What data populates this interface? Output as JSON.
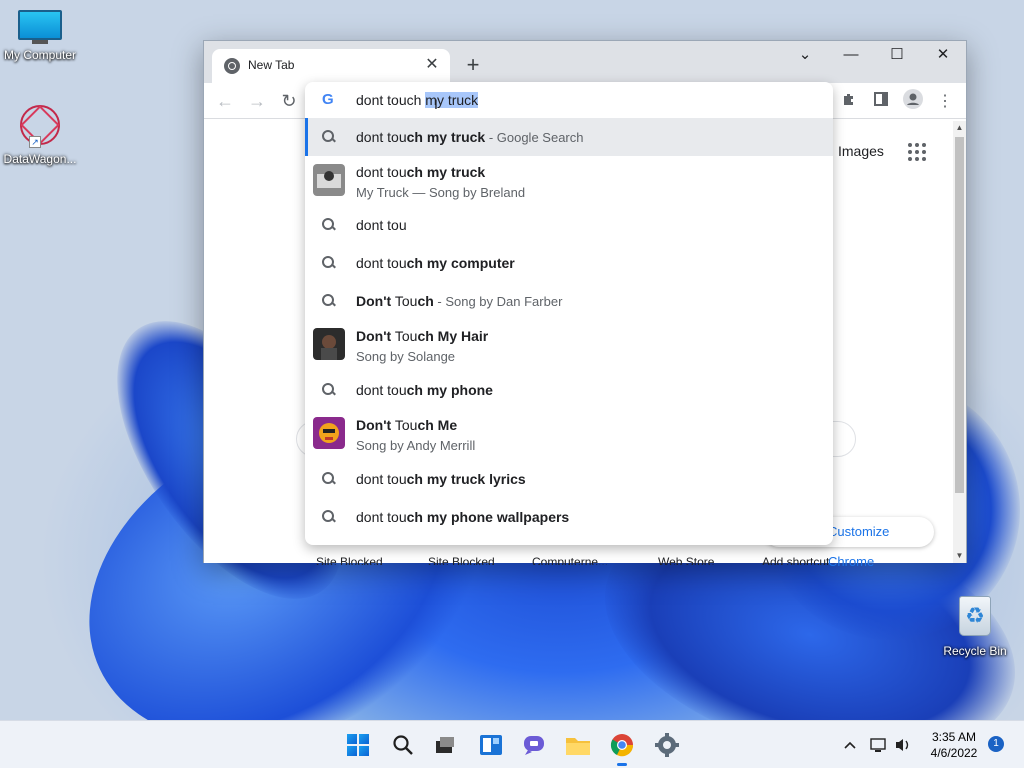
{
  "desktop": {
    "icons": [
      {
        "label": "My Computer",
        "icon": "monitor-icon"
      },
      {
        "label": "DataWagon...",
        "icon": "datawagon-icon"
      },
      {
        "label": "Recycle Bin",
        "icon": "recycle-bin-icon"
      }
    ]
  },
  "browser": {
    "tab": {
      "title": "New Tab",
      "close": "✕"
    },
    "new_tab": "+",
    "window_controls": {
      "dropdown": "⌄",
      "minimize": "—",
      "maximize": "☐",
      "close": "✕"
    },
    "nav": {
      "back": "←",
      "forward": "→",
      "reload": "↻"
    },
    "toolbar_icons": {
      "extensions": "extensions-icon",
      "side_panel": "side-panel-icon",
      "profile": "profile-icon",
      "menu": "⋮"
    },
    "page": {
      "images_link": "Images",
      "customize": "Customize Chrome",
      "shortcuts": [
        "Site Blocked",
        "Site Blocked",
        "Computerne...",
        "Web Store",
        "Add shortcut"
      ]
    }
  },
  "omnibox": {
    "typed": "dont touch",
    "typed_prefix": "dont tou",
    "typed_suffix": "ch ",
    "selected": "my truck",
    "suggestions": [
      {
        "pre": "dont tou",
        "bold": "ch my truck",
        "tail": " - Google Search",
        "type": "search"
      },
      {
        "pre": "dont tou",
        "bold": "ch my truck",
        "sub": "My Truck — Song by Breland",
        "type": "entity"
      },
      {
        "pre": "dont tou",
        "bold": "",
        "type": "search"
      },
      {
        "pre": "dont tou",
        "bold": "ch my computer",
        "type": "search"
      },
      {
        "pre": "Don't",
        "mid": " Tou",
        "bold": "ch",
        "tail": " - Song by Dan Farber",
        "type": "search"
      },
      {
        "pre": "Don't",
        "mid": " Tou",
        "bold": "ch My Hair",
        "sub": "Song by Solange",
        "type": "entity"
      },
      {
        "pre": "dont tou",
        "bold": "ch my phone",
        "type": "search"
      },
      {
        "pre": "Don't",
        "mid": " Tou",
        "bold": "ch Me",
        "sub": "Song by Andy Merrill",
        "type": "entity"
      },
      {
        "pre": "dont tou",
        "bold": "ch my truck lyrics",
        "type": "search"
      },
      {
        "pre": "dont tou",
        "bold": "ch my phone wallpapers",
        "type": "search"
      }
    ]
  },
  "taskbar": {
    "apps": [
      "start-icon",
      "search-icon",
      "task-view-icon",
      "widgets-icon",
      "chat-icon",
      "file-explorer-icon",
      "chrome-icon",
      "settings-icon"
    ],
    "time": "3:35 AM",
    "date": "4/6/2022",
    "notifications": "1",
    "tray": [
      "chevron-up-icon",
      "network-icon",
      "volume-icon"
    ]
  }
}
